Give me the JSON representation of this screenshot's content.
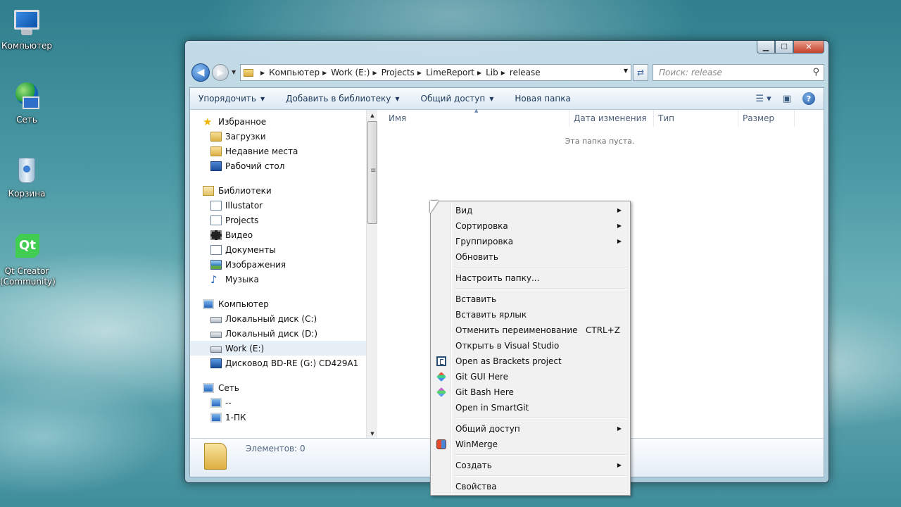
{
  "desktop": {
    "icons": [
      {
        "label": "Компьютер",
        "icon": "computer-icon"
      },
      {
        "label": "Сеть",
        "icon": "network-icon"
      },
      {
        "label": "Корзина",
        "icon": "recycle-bin-icon"
      },
      {
        "label": "Qt Creator (Community)",
        "icon": "qt-creator-icon",
        "glyph": "Qt"
      }
    ]
  },
  "window": {
    "controls": {
      "minimize": "▁",
      "maximize": "☐",
      "close": "✕"
    }
  },
  "address": {
    "crumbs": [
      "Компьютер",
      "Work (E:)",
      "Projects",
      "LimeReport",
      "Lib",
      "release"
    ]
  },
  "search": {
    "placeholder": "Поиск: release"
  },
  "toolbar": {
    "organize": "Упорядочить",
    "add_to_library": "Добавить в библиотеку",
    "share": "Общий доступ",
    "new_folder": "Новая папка"
  },
  "navpane": {
    "favorites": {
      "label": "Избранное",
      "items": [
        "Загрузки",
        "Недавние места",
        "Рабочий стол"
      ]
    },
    "libraries": {
      "label": "Библиотеки",
      "items": [
        "Illustator",
        "Projects",
        "Видео",
        "Документы",
        "Изображения",
        "Музыка"
      ]
    },
    "computer": {
      "label": "Компьютер",
      "items": [
        "Локальный диск (C:)",
        "Локальный диск (D:)",
        "Work (E:)",
        "Дисковод BD-RE (G:) CD429A1"
      ]
    },
    "network": {
      "label": "Сеть",
      "items": [
        "--",
        "1-ПК"
      ]
    }
  },
  "columns": {
    "name": "Имя",
    "date": "Дата изменения",
    "type": "Тип",
    "size": "Размер"
  },
  "content": {
    "empty_message": "Эта папка пуста."
  },
  "details": {
    "count": "Элементов: 0"
  },
  "context_menu": {
    "view": "Вид",
    "sort": "Сортировка",
    "group": "Группировка",
    "refresh": "Обновить",
    "customize": "Настроить папку...",
    "paste": "Вставить",
    "paste_shortcut": "Вставить ярлык",
    "undo_rename": "Отменить переименование",
    "undo_shortcut": "CTRL+Z",
    "open_vs": "Открыть в Visual Studio",
    "open_brackets": "Open as Brackets project",
    "git_gui": "Git GUI Here",
    "git_bash": "Git Bash Here",
    "smartgit": "Open in SmartGit",
    "share": "Общий доступ",
    "winmerge": "WinMerge",
    "create": "Создать",
    "properties": "Свойства"
  }
}
